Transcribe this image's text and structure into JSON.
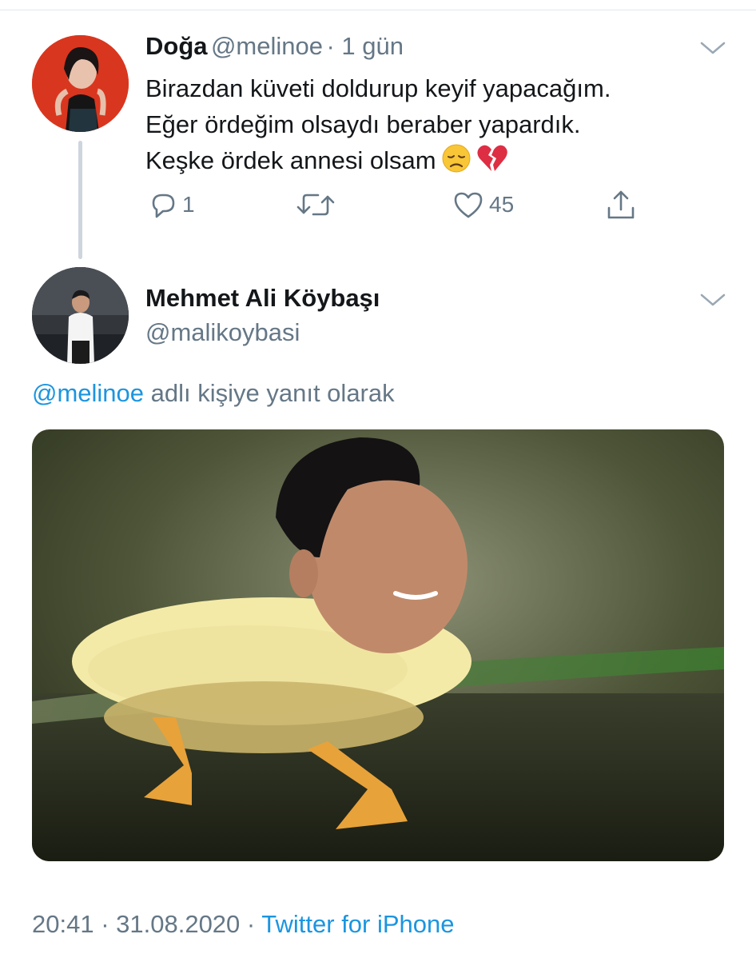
{
  "tweet1": {
    "name": "Doğa",
    "handle": "@melinoe",
    "time": "· 1 gün",
    "lines": [
      "Birazdan küveti doldurup keyif yapacağım.",
      "Eğer ördeğim olsaydı beraber yapardık.",
      "Keşke ördek annesi olsam"
    ],
    "emojis": [
      "disappointed-face-emoji",
      "broken-heart-emoji"
    ],
    "reply_count": "1",
    "like_count": "45"
  },
  "tweet2": {
    "name": "Mehmet Ali Köybaşı",
    "handle": "@malikoybasi",
    "reply_mention": "@melinoe",
    "reply_suffix": " adlı kişiye yanıt olarak",
    "time": "20:41",
    "date": "31.08.2020",
    "separator": " · ",
    "source": "Twitter for iPhone"
  },
  "colors": {
    "accent": "#1b95e0",
    "secondary": "#657786",
    "text": "#14171a"
  },
  "icons": [
    "reply-icon",
    "retweet-icon",
    "like-icon",
    "share-icon",
    "chevron-down-icon"
  ]
}
